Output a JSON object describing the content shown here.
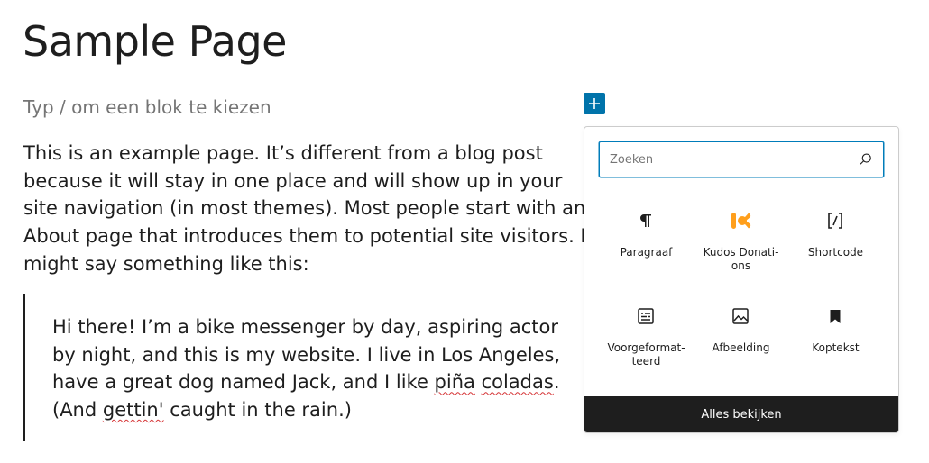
{
  "editor": {
    "page_title": "Sample Page",
    "placeholder": "Typ / om een blok te kiezen",
    "paragraph": "This is an example page. It’s different from a blog post because it will stay in one place and will show up in your site navigation (in most themes). Most people start with an About page that introduces them to potential site visitors. It might say something like this:",
    "quote": {
      "part1": "Hi there! I’m a bike messenger by day, aspiring actor by night, and this is my website. I live in Los Angeles, have a great dog named Jack, and I like ",
      "word1": "piña",
      "space1": " ",
      "word2": "coladas",
      "part2": ". (And ",
      "word3": "gettin'",
      "part3": " caught in the rain.)"
    }
  },
  "inserter": {
    "search_placeholder": "Zoeken",
    "blocks": [
      {
        "label": "Paragraaf",
        "icon": "paragraph-icon"
      },
      {
        "label": "Kudos Donati-ons",
        "icon": "kudos-donations-icon",
        "icon_color": "#ff9f1c"
      },
      {
        "label": "Shortcode",
        "icon": "shortcode-icon"
      },
      {
        "label": "Voorgeformat-teerd",
        "icon": "preformatted-icon"
      },
      {
        "label": "Afbeelding",
        "icon": "image-icon"
      },
      {
        "label": "Koptekst",
        "icon": "heading-bookmark-icon"
      }
    ],
    "browse_all": "Alles bekijken"
  },
  "colors": {
    "accent": "#0073aa",
    "focus": "#007cba",
    "footer_bg": "#1e1e1e"
  }
}
